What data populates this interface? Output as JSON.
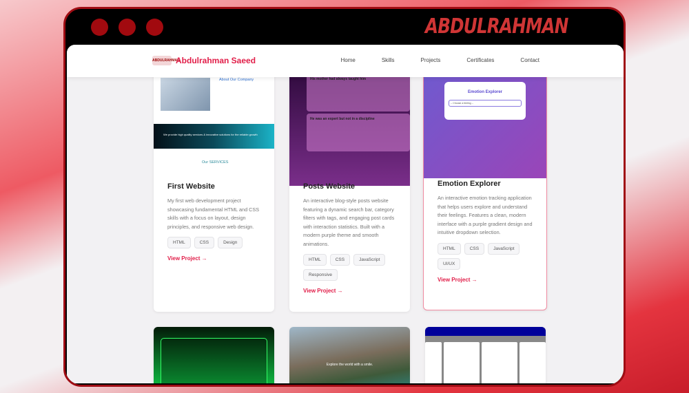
{
  "window": {
    "brand": "ABDULRAHMAN"
  },
  "nav": {
    "logo_text": "ABDULRAHMAN",
    "name": "Abdulrahman Saeed",
    "links": [
      "Home",
      "Skills",
      "Projects",
      "Certificates",
      "Contact"
    ]
  },
  "projects": [
    {
      "title": "First Website",
      "description": "My first web development project showcasing fundamental HTML and CSS skills with a focus on layout, design principles, and responsive web design.",
      "tags": [
        "HTML",
        "CSS",
        "Design"
      ],
      "link": "View Project →",
      "preview": {
        "heading": "About Our Company",
        "banner": "We provide high quality services & innovative solutions for the reliable growth",
        "services": "Our SERVICES"
      }
    },
    {
      "title": "Posts Website",
      "description": "An interactive blog-style posts website featuring a dynamic search bar, category filters with tags, and engaging post cards with interaction statistics. Built with a modern purple theme and smooth animations.",
      "tags": [
        "HTML",
        "CSS",
        "JavaScript",
        "Responsive"
      ],
      "link": "View Project →",
      "preview": {
        "post1": "His mother had always taught him",
        "post2": "He was an expert but not in a discipline"
      }
    },
    {
      "title": "Emotion Explorer",
      "description": "An interactive emotion tracking application that helps users explore and understand their feelings. Features a clean, modern interface with a purple gradient design and intuitive dropdown selection.",
      "tags": [
        "HTML",
        "CSS",
        "JavaScript",
        "UI/UX"
      ],
      "link": "View Project →",
      "preview": {
        "heading": "Emotion Explorer",
        "select": "-- Choose a feeling --"
      }
    }
  ],
  "row2": {
    "landscape_caption": "Explore the world with a smile."
  },
  "colors": {
    "accent": "#e11d48",
    "frame": "#a00d14"
  }
}
